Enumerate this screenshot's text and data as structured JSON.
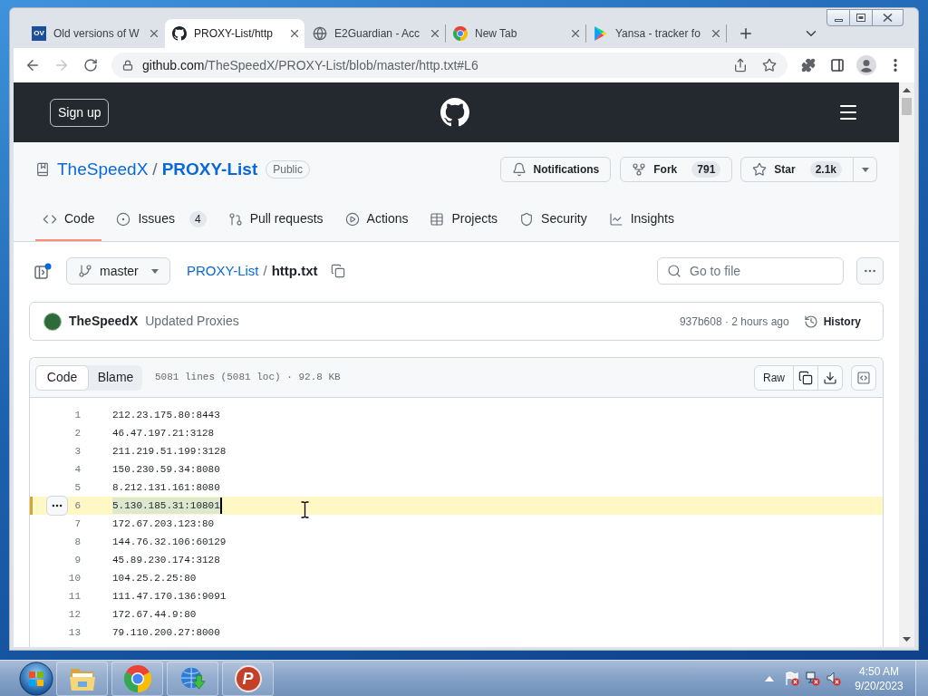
{
  "browser": {
    "tabs": [
      {
        "kind": "badge",
        "favicon_text": "OV",
        "title": "Old versions of W",
        "selected": false
      },
      {
        "kind": "octocat",
        "title": "PROXY-List/http",
        "selected": true
      },
      {
        "kind": "globe",
        "title": "E2Guardian - Acc",
        "selected": false
      },
      {
        "kind": "chrome",
        "title": "New Tab",
        "selected": false
      },
      {
        "kind": "play",
        "title": "Yansa - tracker fo",
        "selected": false
      }
    ],
    "forward_disabled": true,
    "address": {
      "host": "github.com",
      "path": "/TheSpeedX/PROXY-List/blob/master/http.txt#L6"
    }
  },
  "github": {
    "header": {
      "sign_up": "Sign up"
    },
    "repo": {
      "owner": "TheSpeedX",
      "separator": "/",
      "name": "PROXY-List",
      "visibility": "Public"
    },
    "repo_actions": [
      {
        "kind": "bell",
        "label": "Notifications"
      },
      {
        "kind": "fork",
        "label": "Fork",
        "count": "791"
      },
      {
        "kind": "star",
        "label": "Star",
        "count": "2.1k"
      }
    ],
    "repo_nav": [
      {
        "kind": "code",
        "label": "Code",
        "selected": true
      },
      {
        "kind": "issues",
        "label": "Issues",
        "count": "4",
        "selected": false
      },
      {
        "kind": "pulls",
        "label": "Pull requests",
        "selected": false
      },
      {
        "kind": "actions",
        "label": "Actions",
        "selected": false
      },
      {
        "kind": "projects",
        "label": "Projects",
        "selected": false
      },
      {
        "kind": "security",
        "label": "Security",
        "selected": false
      },
      {
        "kind": "insights",
        "label": "Insights",
        "selected": false
      }
    ],
    "file_nav": {
      "branch": "master",
      "breadcrumb_repo": "PROXY-List",
      "breadcrumb_separator": "/",
      "file_name": "http.txt",
      "search_placeholder": "Go to file"
    },
    "latest_commit": {
      "author": "TheSpeedX",
      "message": "Updated Proxies",
      "sha_time": "937b608 · 2 hours ago",
      "history": "History"
    },
    "file": {
      "view_modes": [
        {
          "label": "Code",
          "selected": true
        },
        {
          "label": "Blame",
          "selected": false
        }
      ],
      "info": "5081 lines (5081 loc) · 92.8 KB",
      "raw": "Raw",
      "lines": [
        {
          "number": "1",
          "text": "212.23.175.80:8443",
          "selected": false
        },
        {
          "number": "2",
          "text": "46.47.197.21:3128",
          "selected": false
        },
        {
          "number": "3",
          "text": "211.219.51.199:3128",
          "selected": false
        },
        {
          "number": "4",
          "text": "150.230.59.34:8080",
          "selected": false
        },
        {
          "number": "5",
          "text": "8.212.131.161:8080",
          "selected": false
        },
        {
          "number": "6",
          "text": "5.130.185.31:10801",
          "selected": true
        },
        {
          "number": "7",
          "text": "172.67.203.123:80",
          "selected": false
        },
        {
          "number": "8",
          "text": "144.76.32.106:60129",
          "selected": false
        },
        {
          "number": "9",
          "text": "45.89.230.174:3128",
          "selected": false
        },
        {
          "number": "10",
          "text": "104.25.2.25:80",
          "selected": false
        },
        {
          "number": "11",
          "text": "111.47.170.136:9091",
          "selected": false
        },
        {
          "number": "12",
          "text": "172.67.44.9:80",
          "selected": false
        },
        {
          "number": "13",
          "text": "79.110.200.27:8000",
          "selected": false
        }
      ]
    }
  },
  "taskbar": {
    "pinned_badge_text": "P",
    "time": "4:50 AM",
    "date": "9/20/2023"
  }
}
